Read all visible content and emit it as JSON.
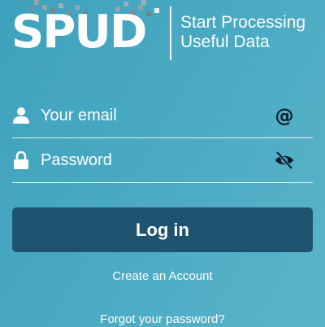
{
  "logo": {
    "wordmark": "SPUD",
    "tagline_line1": "Start Processing",
    "tagline_line2": "Useful Data"
  },
  "form": {
    "email": {
      "placeholder": "Your email",
      "value": "",
      "lead_icon": "user-icon",
      "trail_icon": "at-icon"
    },
    "password": {
      "placeholder": "Password",
      "value": "",
      "lead_icon": "lock-icon",
      "trail_icon": "eye-slash-icon"
    },
    "login_label": "Log in"
  },
  "links": {
    "create_account": "Create an Account",
    "forgot_password": "Forgot your password?"
  },
  "colors": {
    "background_start": "#3ea2bd",
    "background_end": "#5ab4c9",
    "button": "#1e5370",
    "text": "#ffffff",
    "icon_dark": "#0d1b24"
  }
}
